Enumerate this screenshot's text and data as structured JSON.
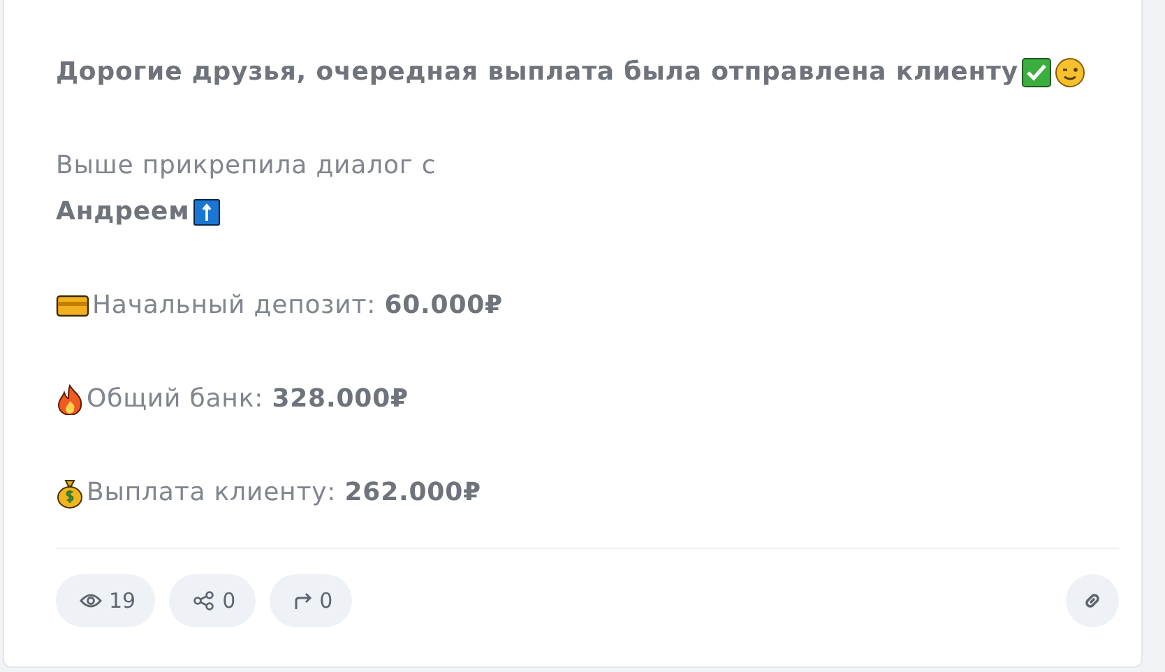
{
  "post": {
    "paragraphs": [
      {
        "lines": [
          {
            "kind": "heading",
            "text": "Дорогие друзья, очередная выплата была отправлена клиенту"
          }
        ]
      },
      {
        "lines": [
          {
            "kind": "plain",
            "text": "Выше прикрепила диалог с"
          },
          {
            "kind": "heading",
            "text": "Андреем"
          }
        ]
      },
      {
        "lines": [
          {
            "kind": "plain",
            "text": "Начальный депозит: **60.000₽**"
          }
        ]
      },
      {
        "lines": [
          {
            "kind": "plain",
            "text": "Общий банк: **328.000₽**"
          }
        ]
      },
      {
        "lines": [
          {
            "kind": "plain",
            "text": "Выплата клиенту: **262.000₽**"
          }
        ]
      }
    ]
  },
  "footer": {
    "stats": [
      {
        "kind": "views",
        "count": "19"
      },
      {
        "kind": "shares",
        "count": "0"
      },
      {
        "kind": "forwards",
        "count": "0"
      }
    ]
  }
}
